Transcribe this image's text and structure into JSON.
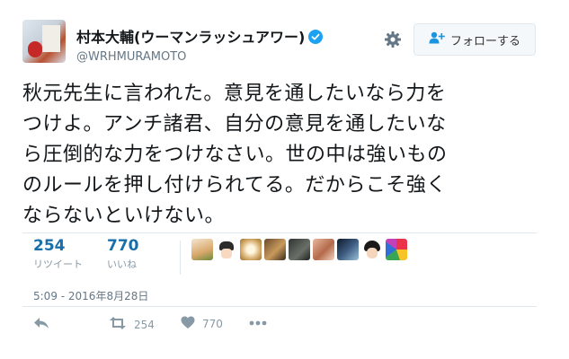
{
  "user": {
    "display_name": "村本大輔(ウーマンラッシュアワー)",
    "handle": "@WRHMURAMOTO"
  },
  "follow_button": {
    "label": "フォローする"
  },
  "tweet": {
    "lines": [
      "秋元先生に言われた。意見を通したいなら力を",
      "つけよ。アンチ諸君、自分の意見を通したいな",
      "ら圧倒的な力をつけなさい。世の中は強いもの",
      "のルールを押し付けられてる。だからこそ強く",
      "ならないといけない。"
    ],
    "timestamp": "5:09 - 2016年8月28日"
  },
  "stats": {
    "retweets": {
      "count": "254",
      "label": "リツイート"
    },
    "likes": {
      "count": "770",
      "label": "いいね"
    }
  },
  "actions": {
    "retweet_count": "254",
    "like_count": "770"
  },
  "colors": {
    "accent": "#1b6fa8",
    "verified": "#1da1f2",
    "muted": "#8899a6"
  },
  "icons": [
    "gear-icon",
    "follow-person-icon",
    "verified-badge-icon",
    "reply-icon",
    "retweet-icon",
    "heart-icon",
    "more-icon"
  ]
}
